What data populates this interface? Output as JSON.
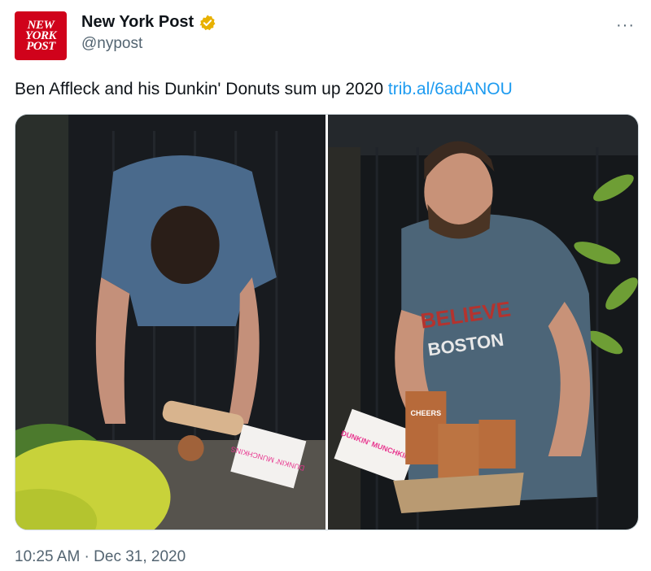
{
  "author": {
    "avatar_lines": [
      "NEW",
      "YORK",
      "POST"
    ],
    "display_name": "New York Post",
    "handle": "@nypost",
    "verified_color": "#e8b100"
  },
  "more_menu": "···",
  "tweet": {
    "text": "Ben Affleck and his Dunkin' Donuts sum up 2020 ",
    "link": "trib.al/6adANOU"
  },
  "photos": [
    {
      "name": "photo-left",
      "prints": [
        "DUNKIN' MUNCHKINS"
      ]
    },
    {
      "name": "photo-right",
      "prints": [
        "BELIEVE",
        "BOSTON",
        "DUNKIN' MUNCHKINS",
        "CHEERS"
      ]
    }
  ],
  "timestamp": "10:25 AM · Dec 31, 2020",
  "colors": {
    "link": "#1d9bf0",
    "muted": "#536471",
    "brand": "#d0021b"
  }
}
